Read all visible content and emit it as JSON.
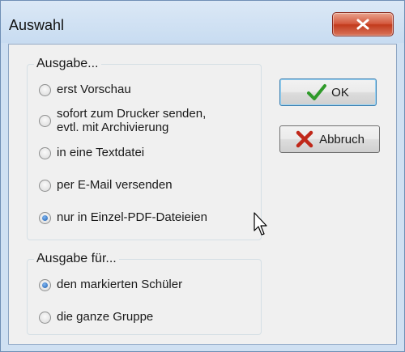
{
  "window": {
    "title": "Auswahl",
    "close_icon": "close-icon"
  },
  "output_group": {
    "legend": "Ausgabe...",
    "options": [
      {
        "label": "erst Vorschau",
        "checked": false
      },
      {
        "label_line1": "sofort zum Drucker senden,",
        "label_line2": "evtl. mit Archivierung",
        "checked": false
      },
      {
        "label": "in eine Textdatei",
        "checked": false
      },
      {
        "label": "per E-Mail versenden",
        "checked": false
      },
      {
        "label": "nur in Einzel-PDF-Dateieien",
        "checked": true
      }
    ]
  },
  "target_group": {
    "legend": "Ausgabe für...",
    "options": [
      {
        "label": "den markierten Schüler",
        "checked": true
      },
      {
        "label": "die ganze Gruppe",
        "checked": false
      }
    ]
  },
  "buttons": {
    "ok": {
      "label": "OK",
      "icon": "checkmark-icon",
      "color": "#2f9a2a"
    },
    "cancel": {
      "label": "Abbruch",
      "icon": "x-mark-icon",
      "color": "#c0281a"
    }
  },
  "cursor_icon": "mouse-pointer-icon"
}
